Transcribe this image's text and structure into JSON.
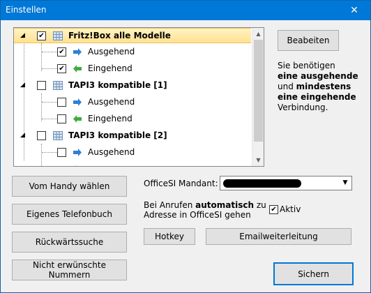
{
  "window": {
    "title": "Einstellen",
    "close_glyph": "✕"
  },
  "tree": {
    "groups": [
      {
        "label": "Fritz!Box alle Modelle",
        "checked": true,
        "selected": true,
        "children": [
          {
            "label": "Ausgehend",
            "icon": "arrow-right-icon",
            "checked": true
          },
          {
            "label": "Eingehend",
            "icon": "arrow-left-icon",
            "checked": true
          }
        ]
      },
      {
        "label": "TAPI3 kompatible [1]",
        "checked": false,
        "selected": false,
        "children": [
          {
            "label": "Ausgehend",
            "icon": "arrow-right-icon",
            "checked": false
          },
          {
            "label": "Eingehend",
            "icon": "arrow-left-icon",
            "checked": false
          }
        ]
      },
      {
        "label": "TAPI3 kompatible [2]",
        "checked": false,
        "selected": false,
        "children": [
          {
            "label": "Ausgehend",
            "icon": "arrow-right-icon",
            "checked": false
          }
        ]
      }
    ],
    "check_glyph": "✔",
    "expander_glyph": "◢",
    "scroll_up": "▲",
    "scroll_down": "▼"
  },
  "buttons": {
    "bearbeiten": "Beabeiten",
    "handy": "Vom Handy wählen",
    "telefonbuch": "Eigenes Telefonbuch",
    "rueckwaerts": "Rückwärtssuche",
    "unerwuenscht": "Nicht erwünschte Nummern",
    "hotkey": "Hotkey",
    "email": "Emailweiterleitung",
    "sichern": "Sichern"
  },
  "info": {
    "line1": "Sie benötigen",
    "line2": "eine ausgehende",
    "line3_pre": "und ",
    "line3_bold": "mindestens",
    "line4": "eine eingehende",
    "line5": "Verbindung."
  },
  "mandant": {
    "label": "OfficeSI Mandant:",
    "dropdown_glyph": "▼"
  },
  "anrufen": {
    "text_pre": "Bei Anrufen ",
    "text_bold": "automatisch",
    "text_post": " zu",
    "line2": "Adresse in OfficeSI gehen",
    "checkbox_label": "Aktiv",
    "checked": true
  },
  "colors": {
    "titlebar": "#0078d7",
    "selection": "#ffe190",
    "arrow_out": "#2f7fd6",
    "arrow_in": "#3cae3c"
  }
}
